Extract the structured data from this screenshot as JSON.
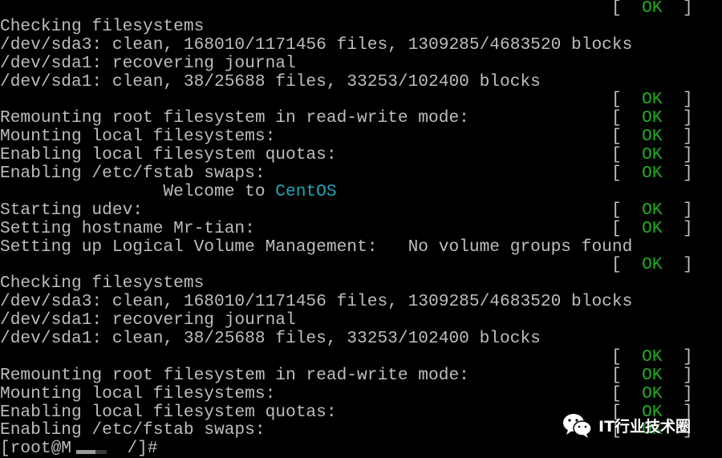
{
  "colors": {
    "text": "#bdbdbd",
    "ok": "#1fae1f",
    "brand": "#20a6b8",
    "background": "#000000"
  },
  "status_ok": {
    "open": "[",
    "label": "OK",
    "close": "]"
  },
  "rows": [
    {
      "text": "",
      "status": true
    },
    {
      "text": "Checking filesystems",
      "status": false
    },
    {
      "text": "/dev/sda3: clean, 168010/1171456 files, 1309285/4683520 blocks",
      "status": false
    },
    {
      "text": "/dev/sda1: recovering journal",
      "status": false
    },
    {
      "text": "/dev/sda1: clean, 38/25688 files, 33253/102400 blocks",
      "status": false
    },
    {
      "text": "",
      "status": true
    },
    {
      "text": "Remounting root filesystem in read-write mode:",
      "status": true
    },
    {
      "text": "Mounting local filesystems:",
      "status": true
    },
    {
      "text": "Enabling local filesystem quotas:",
      "status": true
    },
    {
      "text": "Enabling /etc/fstab swaps:",
      "status": true
    },
    {
      "text": "                Welcome to ",
      "highlight": "CentOS",
      "status": false
    },
    {
      "text": "Starting udev:",
      "status": true
    },
    {
      "text": "Setting hostname Mr-tian:",
      "status": true
    },
    {
      "text": "Setting up Logical Volume Management:   No volume groups found",
      "status": false
    },
    {
      "text": "",
      "status": true
    },
    {
      "text": "Checking filesystems",
      "status": false
    },
    {
      "text": "/dev/sda3: clean, 168010/1171456 files, 1309285/4683520 blocks",
      "status": false
    },
    {
      "text": "/dev/sda1: recovering journal",
      "status": false
    },
    {
      "text": "/dev/sda1: clean, 38/25688 files, 33253/102400 blocks",
      "status": false
    },
    {
      "text": "",
      "status": true
    },
    {
      "text": "Remounting root filesystem in read-write mode:",
      "status": true
    },
    {
      "text": "Mounting local filesystems:",
      "status": true
    },
    {
      "text": "Enabling local filesystem quotas:",
      "status": true
    },
    {
      "text": "Enabling /etc/fstab swaps:",
      "status": true
    }
  ],
  "prompt": {
    "prefix": "[root@M",
    "suffix": "  /]#"
  },
  "watermark": {
    "icon": "wechat-icon",
    "text": "IT行业技术圈"
  }
}
